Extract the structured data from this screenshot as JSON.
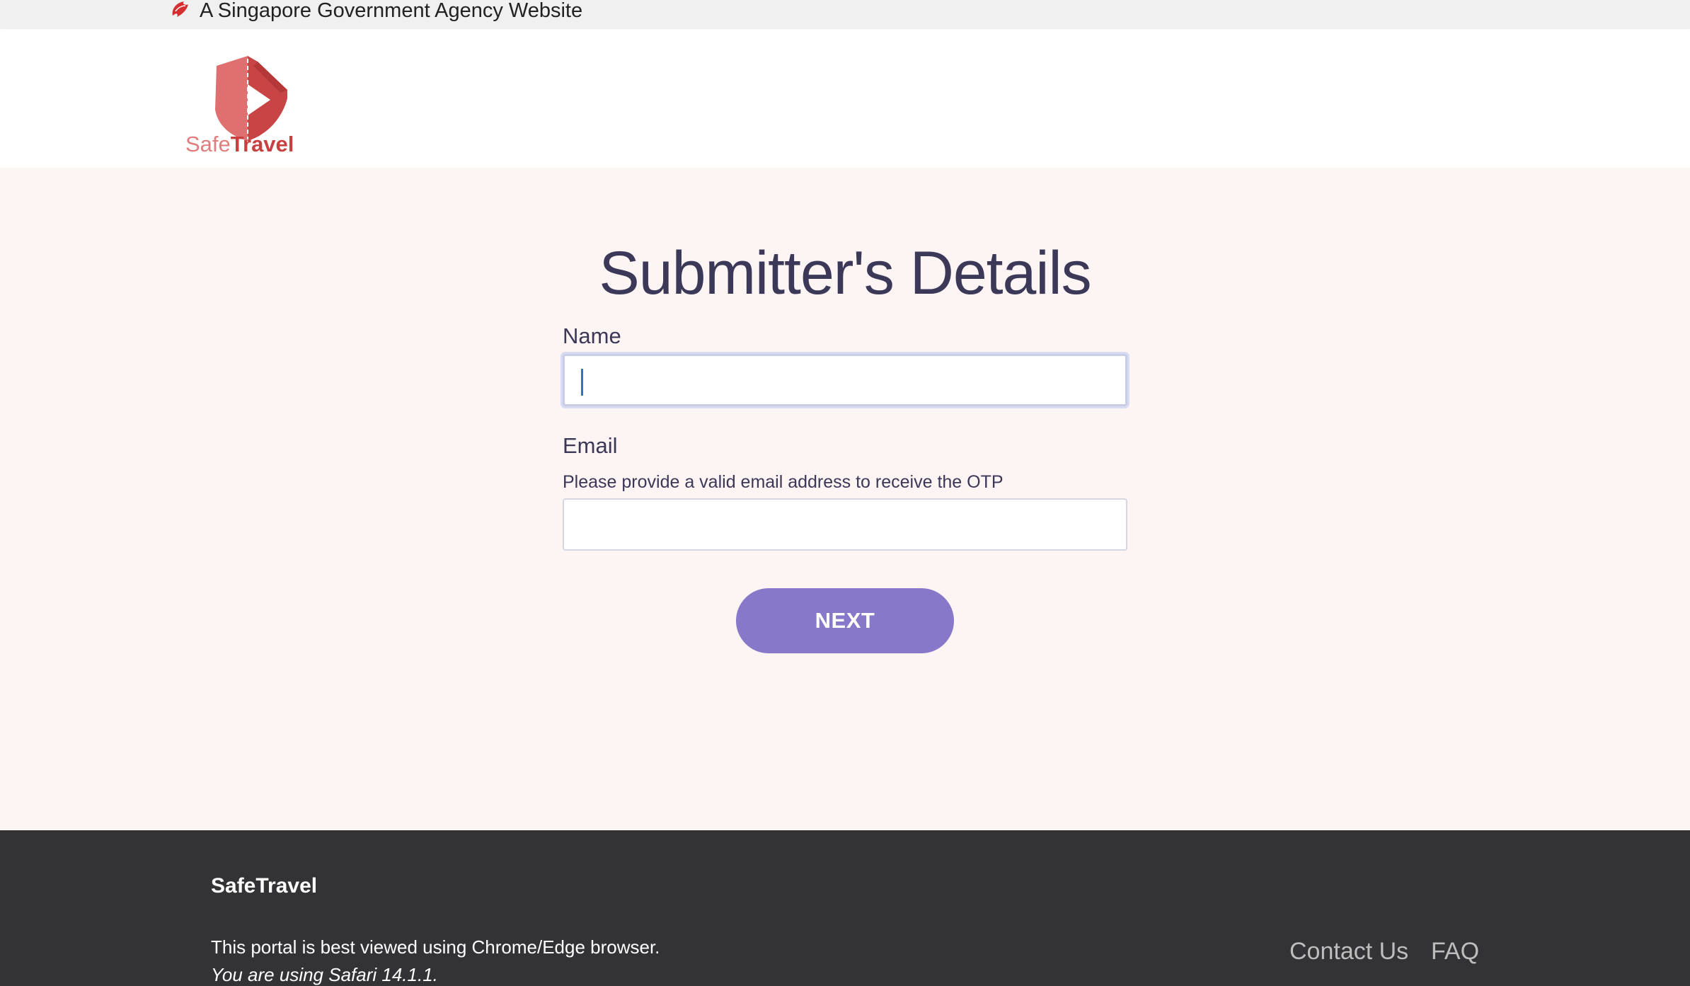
{
  "masthead": {
    "text": "A Singapore Government Agency Website"
  },
  "header": {
    "logo_text_safe": "Safe",
    "logo_text_travel": "Travel"
  },
  "form": {
    "title": "Submitter's Details",
    "name_label": "Name",
    "name_value": "",
    "email_label": "Email",
    "email_hint": "Please provide a valid email address to receive the OTP",
    "email_value": "",
    "next_label": "NEXT"
  },
  "footer": {
    "brand": "SafeTravel",
    "note": "This portal is best viewed using Chrome/Edge browser.",
    "browser": "You are using Safari 14.1.1.",
    "links": [
      "Contact Us",
      "FAQ"
    ]
  },
  "colors": {
    "accent": "#8778c9",
    "title": "#3b3858",
    "page_bg": "#fdf4f4",
    "footer_bg": "#333235",
    "brand_red": "#c94040"
  }
}
